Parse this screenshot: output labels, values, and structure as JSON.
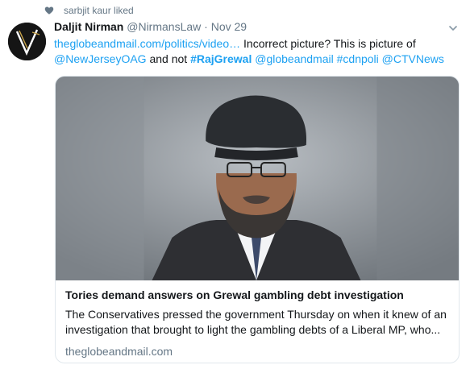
{
  "liked_banner": {
    "text": "sarbjit kaur liked",
    "icon": "heart-icon"
  },
  "tweet": {
    "display_name": "Daljit Nirman",
    "handle": "@NirmansLaw",
    "separator": "·",
    "date": "Nov 29",
    "link_text": "theglobeandmail.com/politics/video…",
    "text_1": " Incorrect picture?  This is picture of ",
    "mention_1": "@NewJerseyOAG",
    "text_2": " and not ",
    "hashtag_1": "#RajGrewal",
    "mention_2": "@globeandmail",
    "hashtag_2": "#cdnpoli",
    "mention_3": "@CTVNews"
  },
  "card": {
    "title": "Tories demand answers on Grewal gambling debt investigation",
    "description": "The Conservatives pressed the government Thursday on when it knew of an investigation that brought to light the gambling debts of a Liberal MP, who...",
    "domain": "theglobeandmail.com"
  },
  "colors": {
    "link": "#1da1f2",
    "muted": "#657786",
    "text": "#14171a",
    "border": "#e1e8ed"
  }
}
